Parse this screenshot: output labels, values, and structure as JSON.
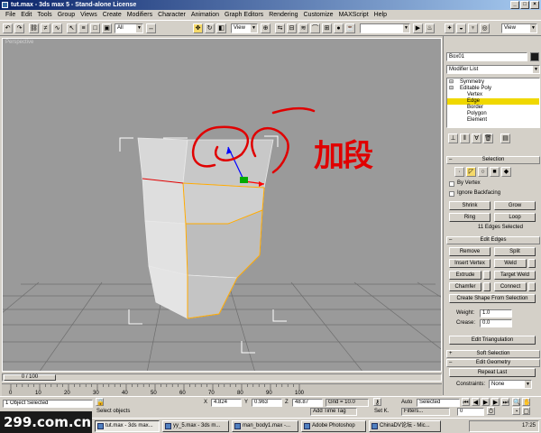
{
  "window": {
    "title": "tut.max - 3ds max 5 - Stand-alone License"
  },
  "menu": [
    "File",
    "Edit",
    "Tools",
    "Group",
    "Views",
    "Create",
    "Modifiers",
    "Character",
    "Animation",
    "Graph Editors",
    "Rendering",
    "Customize",
    "MAXScript",
    "Help"
  ],
  "toolbar": {
    "selection_filter": "All",
    "ref_coord": "View",
    "ref_coord2": "View"
  },
  "viewport": {
    "label": "Perspective",
    "annotation": "加段"
  },
  "panel": {
    "object_name": "Box01",
    "modifier_list": "Modifier List",
    "stack": [
      {
        "label": "Symmetry",
        "level": 0,
        "selected": false
      },
      {
        "label": "Editable Poly",
        "level": 0,
        "selected": false
      },
      {
        "label": "Vertex",
        "level": 1,
        "selected": false
      },
      {
        "label": "Edge",
        "level": 1,
        "selected": true
      },
      {
        "label": "Border",
        "level": 1,
        "selected": false
      },
      {
        "label": "Polygon",
        "level": 1,
        "selected": false
      },
      {
        "label": "Element",
        "level": 1,
        "selected": false
      }
    ],
    "selection": {
      "title": "Selection",
      "by_vertex": "By Vertex",
      "ignore_backfacing": "Ignore Backfacing",
      "shrink": "Shrink",
      "grow": "Grow",
      "ring": "Ring",
      "loop": "Loop",
      "status": "11 Edges Selected"
    },
    "edit_edges": {
      "title": "Edit Edges",
      "remove": "Remove",
      "split": "Split",
      "insert_vertex": "Insert Vertex",
      "weld": "Weld",
      "extrude": "Extrude",
      "target_weld": "Target Weld",
      "chamfer": "Chamfer",
      "connect": "Connect",
      "create_shape": "Create Shape From Selection",
      "weight_label": "Weight:",
      "weight_value": "1.0",
      "crease_label": "Crease:",
      "crease_value": "0.0",
      "edit_triangulation": "Edit Triangulation"
    },
    "soft_selection": "Soft Selection",
    "edit_geometry": "Edit Geometry",
    "repeat_last": "Repeat Last",
    "constraints_label": "Constraints:",
    "constraints_value": "None"
  },
  "timeline": {
    "position": "0 / 100",
    "ticks": [
      "0",
      "10",
      "20",
      "30",
      "40",
      "50",
      "60",
      "70",
      "80",
      "90",
      "100"
    ]
  },
  "status": {
    "selection_count": "1 Object Selected",
    "prompt": "Select objects",
    "x_label": "X",
    "x_value": "4.824",
    "y_label": "Y",
    "y_value": "0.963",
    "z_label": "Z",
    "z_value": "48.87",
    "grid": "Grid = 10.0",
    "add_time_tag": "Add Time Tag",
    "auto_label": "Auto",
    "set_k_label": "Set K.",
    "key_mode": "Selected",
    "filters": "Filters...",
    "frame": "0"
  },
  "taskbar": {
    "tasks": [
      "tut.max - 3ds max...",
      "yy_5.max - 3ds m...",
      "man_body1.max -...",
      "Adobe Photoshop",
      "ChinaDV论坛 - Mic..."
    ],
    "clock": "17:25"
  },
  "watermark": "299.com.cn",
  "colors": {
    "annotation": "#e00000",
    "selected_stack": "#f0d800",
    "selected_edges": "#ffaa00"
  }
}
